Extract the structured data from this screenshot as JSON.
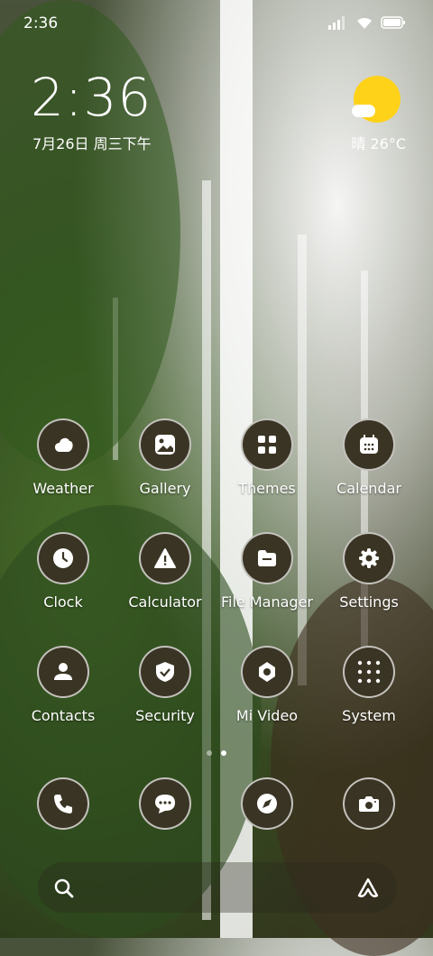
{
  "status_bar": {
    "time": "2:36"
  },
  "widget": {
    "clock": "2:36",
    "date": "7月26日 周三下午",
    "weather": "晴 26°C"
  },
  "apps": [
    {
      "label": "Weather",
      "icon": "weather-icon"
    },
    {
      "label": "Gallery",
      "icon": "gallery-icon"
    },
    {
      "label": "Themes",
      "icon": "themes-icon"
    },
    {
      "label": "Calendar",
      "icon": "calendar-icon"
    },
    {
      "label": "Clock",
      "icon": "clock-icon"
    },
    {
      "label": "Calculator",
      "icon": "calculator-icon"
    },
    {
      "label": "File Manager",
      "icon": "file-manager-icon"
    },
    {
      "label": "Settings",
      "icon": "settings-icon"
    },
    {
      "label": "Contacts",
      "icon": "contacts-icon"
    },
    {
      "label": "Security",
      "icon": "security-icon"
    },
    {
      "label": "Mi Video",
      "icon": "mi-video-icon"
    },
    {
      "label": "System",
      "icon": "system-folder-icon"
    }
  ],
  "dock": [
    {
      "icon": "phone-icon"
    },
    {
      "icon": "messages-icon"
    },
    {
      "icon": "browser-compass-icon"
    },
    {
      "icon": "camera-icon"
    }
  ],
  "colors": {
    "icon_bg": "#3a3424",
    "sun": "#ffd21a"
  }
}
